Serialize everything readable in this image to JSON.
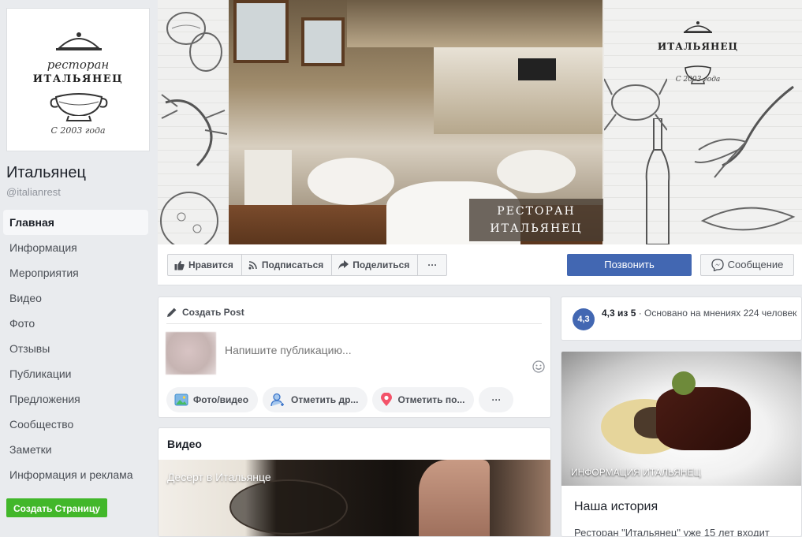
{
  "sidebar": {
    "logo": {
      "script_text": "ресторан",
      "name": "ИТАЛЬЯНЕЦ",
      "year": "С 2003 года"
    },
    "page_name": "Итальянец",
    "handle": "@italianrest",
    "nav": [
      {
        "label": "Главная",
        "active": true
      },
      {
        "label": "Информация"
      },
      {
        "label": "Мероприятия"
      },
      {
        "label": "Видео"
      },
      {
        "label": "Фото"
      },
      {
        "label": "Отзывы"
      },
      {
        "label": "Публикации"
      },
      {
        "label": "Предложения"
      },
      {
        "label": "Сообщество"
      },
      {
        "label": "Заметки"
      },
      {
        "label": "Информация и реклама"
      }
    ],
    "create_page_label": "Создать Страницу"
  },
  "cover": {
    "caption_line1": "РЕСТОРАН",
    "caption_line2": "ИТАЛЬЯНЕЦ",
    "right_logo_name": "ИТАЛЬЯНЕЦ",
    "right_logo_year": "С 2003 года"
  },
  "actions": {
    "like": "Нравится",
    "follow": "Подписаться",
    "share": "Поделиться",
    "more": "···",
    "call": "Позвонить",
    "message": "Сообщение"
  },
  "composer": {
    "header": "Создать Post",
    "placeholder": "Напишите публикацию...",
    "chips": [
      {
        "label": "Фото/видео",
        "icon": "photo-icon"
      },
      {
        "label": "Отметить др...",
        "icon": "tag-friends-icon"
      },
      {
        "label": "Отметить по...",
        "icon": "location-pin-icon"
      }
    ],
    "more": "···"
  },
  "video": {
    "title": "Видео",
    "caption": "Десерт в Итальянце"
  },
  "rating": {
    "score": "4,3",
    "score_text": "4,3 из 5",
    "separator": " · ",
    "basis": "Основано на мнениях 224 человек"
  },
  "story": {
    "image_caption": "ИНФОРМАЦИЯ ИТАЛЬЯНЕЦ",
    "title": "Наша история",
    "text": "Ресторан \"Итальянец\" уже 15 лет входит"
  },
  "colors": {
    "primary": "#4267b2",
    "create_page": "#42b72a",
    "background": "#e9ebee"
  }
}
